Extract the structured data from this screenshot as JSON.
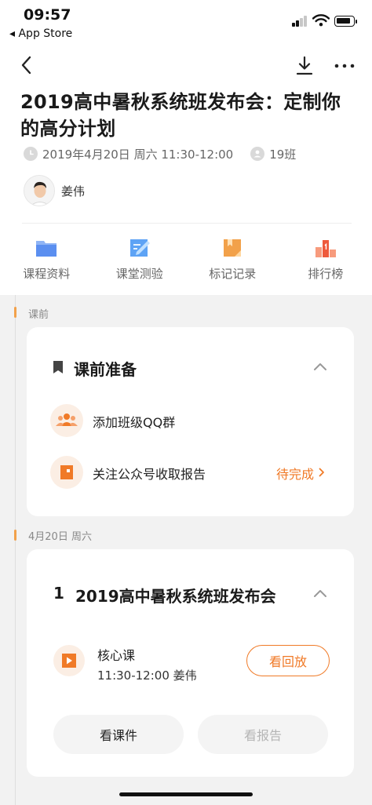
{
  "status_bar": {
    "time": "09:57",
    "back_app": "◂ App Store"
  },
  "lecture": {
    "title": "2019高中暑秋系统班发布会：定制你的高分计划",
    "datetime": "2019年4月20日 周六 11:30-12:00",
    "class_count": "19班",
    "teacher": "姜伟"
  },
  "tools": [
    {
      "label": "课程资料",
      "icon": "folder-icon",
      "color": "#5b8ff0"
    },
    {
      "label": "课堂测验",
      "icon": "quiz-icon",
      "color": "#5da3f5"
    },
    {
      "label": "标记记录",
      "icon": "bookmark-note-icon",
      "color": "#f2a14a"
    },
    {
      "label": "排行榜",
      "icon": "podium-icon",
      "color": "#ee6a4a"
    }
  ],
  "sections": {
    "pre_label": "课前",
    "date_label": "4月20日 周六"
  },
  "prep_card": {
    "title": "课前准备",
    "items": [
      {
        "text": "添加班级QQ群",
        "status": ""
      },
      {
        "text": "关注公众号收取报告",
        "status": "待完成"
      }
    ]
  },
  "session_card": {
    "index": "1",
    "title": "2019高中暑秋系统班发布会",
    "lesson_type": "核心课",
    "lesson_time": "11:30-12:00 姜伟",
    "replay_label": "看回放",
    "courseware_label": "看课件",
    "report_label": "看报告"
  },
  "colors": {
    "accent": "#f07a27",
    "icon_bg": "#fbeee4",
    "timeline_accent": "#f2a14a",
    "disabled_text": "#b5b5b5"
  }
}
